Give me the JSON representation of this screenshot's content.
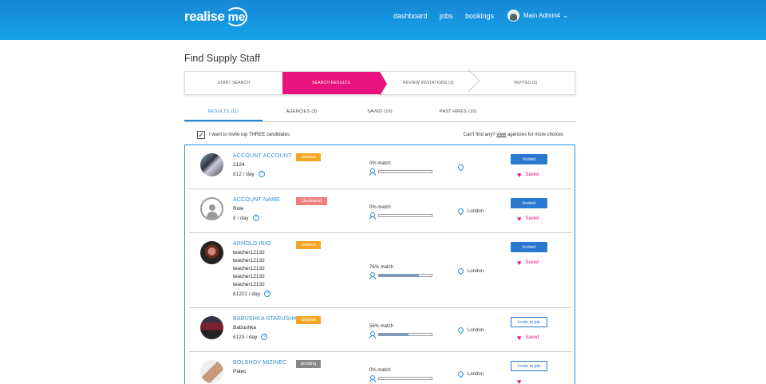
{
  "header": {
    "logo_text": "realise",
    "logo_me": "me",
    "nav": [
      "dashboard",
      "jobs",
      "bookings"
    ],
    "user_name": "Main Admin4",
    "user_chevron": "⌄"
  },
  "page": {
    "title": "Find Supply Staff"
  },
  "steps": [
    "START SEARCH",
    "SEARCH RESULTS",
    "REVIEW INVITATIONS (3)",
    "INVITES (3)"
  ],
  "tabs": [
    "RESULTS (11)",
    "AGENCIES (3)",
    "SAVED (16)",
    "PAST HIRES (10)"
  ],
  "invite_check": {
    "checked": true,
    "mark": "✓",
    "label": "I want to invite top THREE candidates"
  },
  "find_agencies": {
    "prefix": "Can't find any?",
    "link": "view",
    "suffix": "agencies for more choices"
  },
  "results": [
    {
      "name": "ACCOUNT ACCOUNT",
      "status": "cleared",
      "roles": [
        "2124"
      ],
      "rate": "£12",
      "unit": "/ day",
      "match": "0% match",
      "match_value": 0,
      "location": "",
      "button": "Invited",
      "saved": "Saved"
    },
    {
      "name": "ACCOUNT NAME",
      "status": "Uncleared",
      "roles": [
        "Role"
      ],
      "rate": "£",
      "unit": "/ day",
      "match": "0% match",
      "match_value": 0,
      "location": "London",
      "button": "Invited",
      "saved": "Saved"
    },
    {
      "name": "ARNOLD INIO",
      "status": "cleared",
      "roles": [
        "teacher12132",
        "teacher12132",
        "teacher12132",
        "teacher12132",
        "teacher12132"
      ],
      "rate": "£1221",
      "unit": "/ day",
      "match": "76% match",
      "match_value": 76,
      "location": "London",
      "button": "Invited",
      "saved": "Saved"
    },
    {
      "name": "BABUSHKA STARUSHKA",
      "status": "cleared",
      "roles": [
        "Babushka"
      ],
      "rate": "£123",
      "unit": "/ day",
      "match": "56% match",
      "match_value": 56,
      "location": "London",
      "button": "Invite to job",
      "saved": "Saved"
    },
    {
      "name": "BOLSHOY MIZINEC",
      "status": "pending",
      "roles": [
        "Paleс"
      ],
      "rate": "",
      "unit": "",
      "match": "0% match",
      "match_value": 0,
      "location": "London",
      "button": "Invite to job",
      "saved": ""
    }
  ],
  "icons": {
    "help": "?",
    "heart": "♥"
  },
  "colors": {
    "header": "#16a3e8",
    "accent": "#e8137e",
    "link": "#2a8fd8",
    "cleared": "#f5a623",
    "uncleared": "#f08080",
    "pending": "#888888"
  }
}
